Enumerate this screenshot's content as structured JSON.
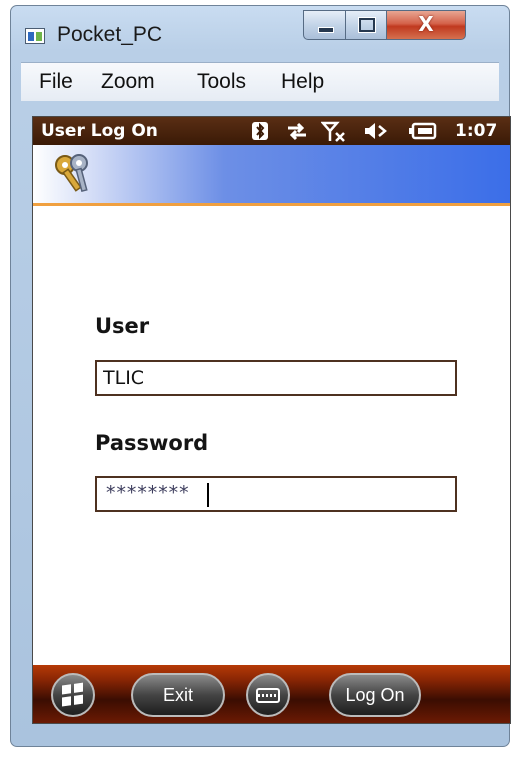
{
  "window": {
    "title": "Pocket_PC",
    "close_glyph": "X"
  },
  "menu": {
    "items": [
      "File",
      "Zoom",
      "Tools",
      "Help"
    ]
  },
  "status_bar": {
    "title": "User Log On",
    "icons": [
      "bluetooth-icon",
      "sync-icon",
      "signal-off-icon",
      "volume-muted-icon",
      "battery-icon"
    ],
    "time": "1:07"
  },
  "banner": {
    "icon": "keys-icon",
    "accent_color": "#f0a040"
  },
  "form": {
    "user_label": "User",
    "user_value": "TLIC",
    "password_label": "Password",
    "password_value": "********"
  },
  "softkeys": {
    "exit_label": "Exit",
    "logon_label": "Log On"
  }
}
